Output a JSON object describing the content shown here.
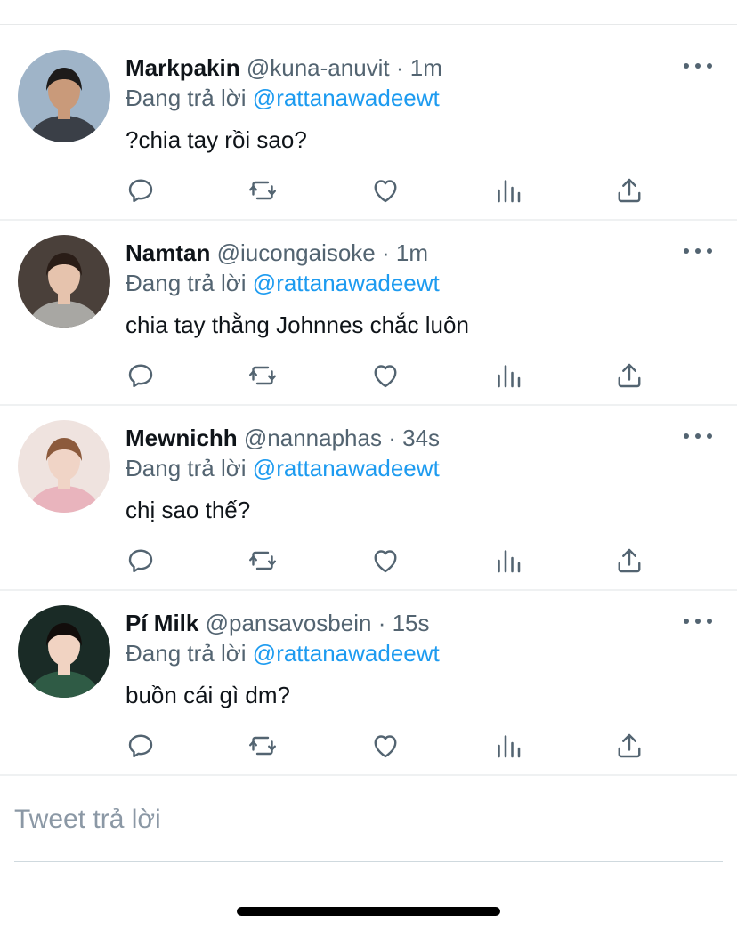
{
  "replies": [
    {
      "name": "Markpakin",
      "handle": "@kuna-anuvit",
      "separator": "·",
      "time": "1m",
      "reply_prefix": "Đang trả lời",
      "reply_to": "@rattanawadeewt",
      "text": "?chia tay rồi sao?",
      "avatar_colors": {
        "bg": "#9fb4c8",
        "skin": "#c99a7a",
        "hair": "#1d1b1a",
        "cloth": "#3a3f47"
      }
    },
    {
      "name": "Namtan",
      "handle": "@iucongaisoke",
      "separator": "·",
      "time": "1m",
      "reply_prefix": "Đang trả lời",
      "reply_to": "@rattanawadeewt",
      "text": "chia tay thằng Johnnes chắc luôn",
      "avatar_colors": {
        "bg": "#4a403a",
        "skin": "#e6c3ad",
        "hair": "#2a1d17",
        "cloth": "#a8a7a3"
      }
    },
    {
      "name": "Mewnichh",
      "handle": "@nannaphas",
      "separator": "·",
      "time": "34s",
      "reply_prefix": "Đang trả lời",
      "reply_to": "@rattanawadeewt",
      "text": "chị sao thế?",
      "avatar_colors": {
        "bg": "#efe3df",
        "skin": "#f0d4c6",
        "hair": "#8c5a3c",
        "cloth": "#e9b4bd"
      }
    },
    {
      "name": "Pí Milk",
      "handle": "@pansavosbein",
      "separator": "·",
      "time": "15s",
      "reply_prefix": "Đang trả lời",
      "reply_to": "@rattanawadeewt",
      "text": "buồn cái gì dm?",
      "avatar_colors": {
        "bg": "#1a2b26",
        "skin": "#f1d3c2",
        "hair": "#120d0b",
        "cloth": "#2f5b45"
      }
    }
  ],
  "icons": {
    "reply": "reply-icon",
    "retweet": "retweet-icon",
    "like": "like-icon",
    "stats": "stats-icon",
    "share": "share-icon",
    "more": "more-icon"
  },
  "composer": {
    "placeholder": "Tweet trả lời"
  },
  "colors": {
    "accent": "#1d9bf0",
    "muted": "#536471",
    "text": "#0f1419"
  }
}
